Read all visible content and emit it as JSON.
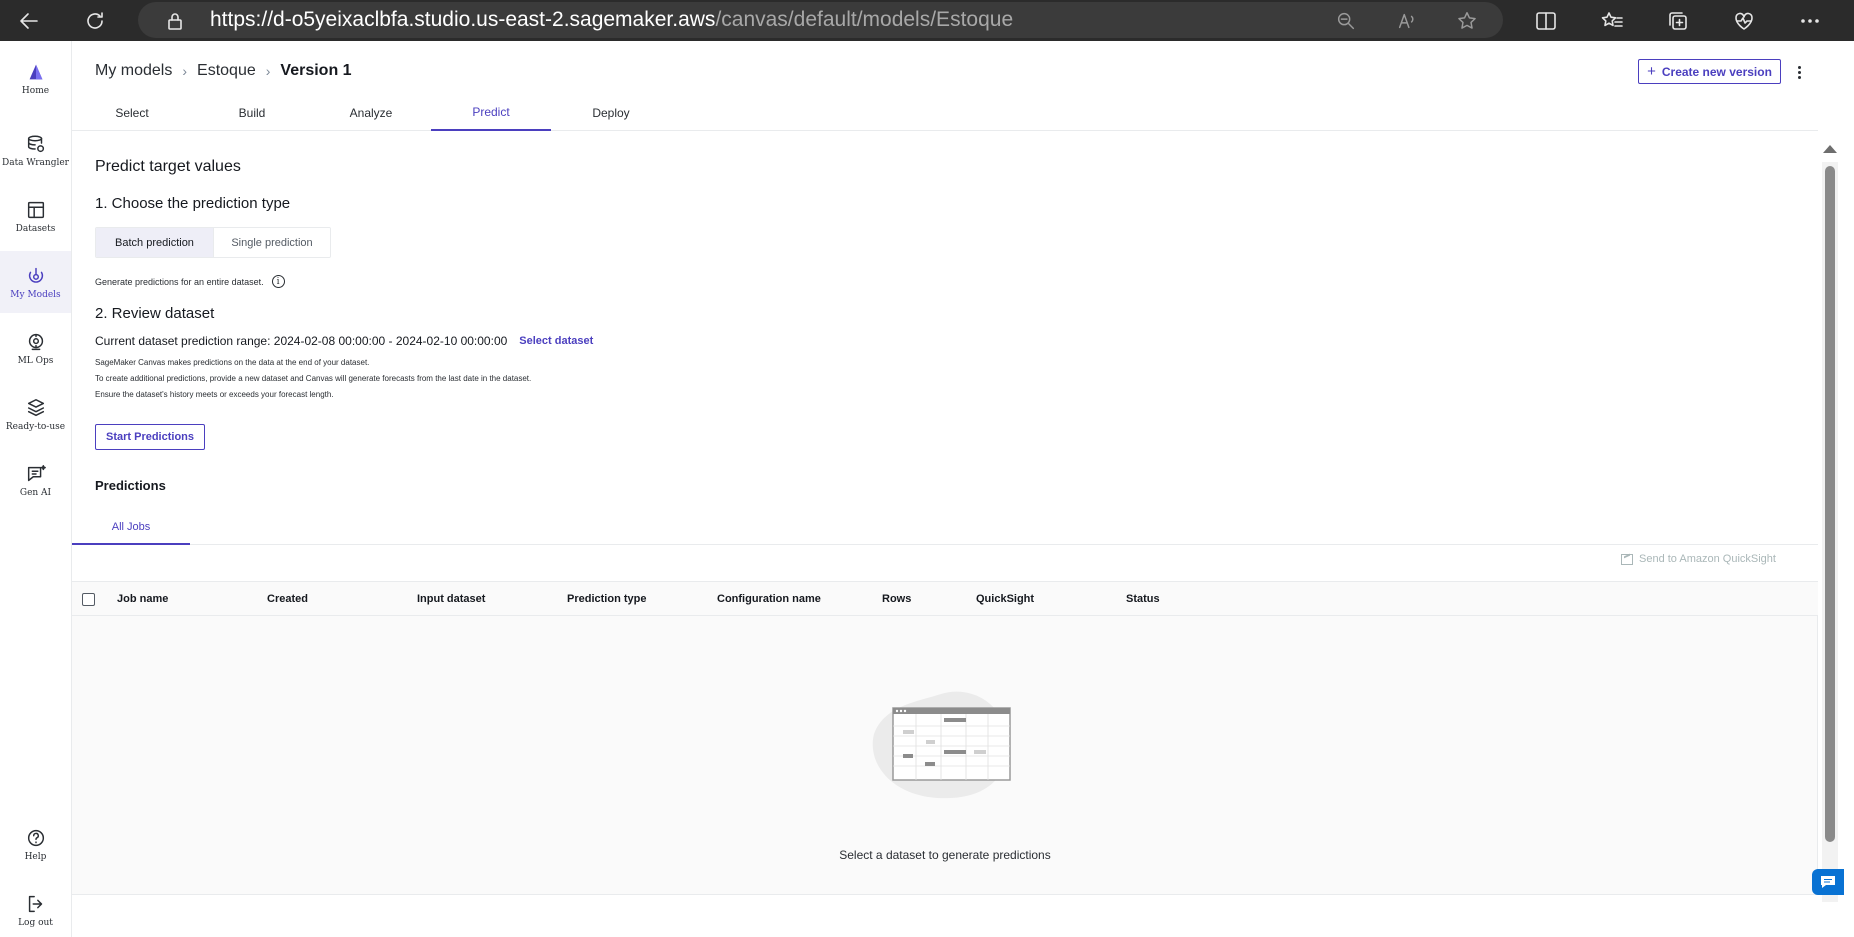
{
  "browser": {
    "url_host": "https://d-o5yeixaclbfa.studio.us-east-2.sagemaker.aws",
    "url_path": "/canvas/default/models/Estoque"
  },
  "rail": {
    "items": [
      {
        "label": "Home",
        "icon": "canvas-logo-icon"
      },
      {
        "label": "Data Wrangler",
        "icon": "data-wrangler-icon"
      },
      {
        "label": "Datasets",
        "icon": "datasets-icon"
      },
      {
        "label": "My Models",
        "icon": "models-icon"
      },
      {
        "label": "ML Ops",
        "icon": "ml-ops-icon"
      },
      {
        "label": "Ready-to-use",
        "icon": "ready-to-use-icon"
      },
      {
        "label": "Gen AI",
        "icon": "gen-ai-icon"
      },
      {
        "label": "Help",
        "icon": "help-icon"
      },
      {
        "label": "Log out",
        "icon": "logout-icon"
      }
    ]
  },
  "breadcrumb": {
    "root": "My models",
    "model": "Estoque",
    "current": "Version 1"
  },
  "header": {
    "create_label": "Create new version"
  },
  "steps": [
    "Select",
    "Build",
    "Analyze",
    "Predict",
    "Deploy"
  ],
  "predict": {
    "title": "Predict target values",
    "section1": "1. Choose the prediction type",
    "batch_label": "Batch prediction",
    "single_label": "Single prediction",
    "batch_desc": "Generate predictions for an entire dataset.",
    "section2": "2. Review dataset",
    "range_text": "Current dataset prediction range: 2024-02-08 00:00:00 - 2024-02-10 00:00:00",
    "select_dataset": "Select dataset",
    "notes": [
      "SageMaker Canvas makes predictions on the data at the end of your dataset.",
      "To create additional predictions, provide a new dataset and Canvas will generate forecasts from the last date in the dataset.",
      "Ensure the dataset's history meets or exceeds your forecast length."
    ],
    "start_label": "Start Predictions"
  },
  "predictions": {
    "title": "Predictions",
    "tab": "All Jobs",
    "quicksight_label": "Send to Amazon QuickSight",
    "columns": [
      "Job name",
      "Created",
      "Input dataset",
      "Prediction type",
      "Configuration name",
      "Rows",
      "QuickSight",
      "Status"
    ],
    "empty_text": "Select a dataset to generate predictions"
  }
}
